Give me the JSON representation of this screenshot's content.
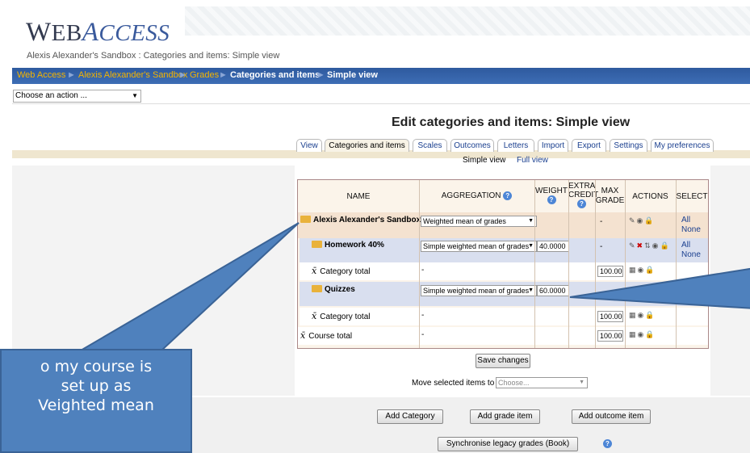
{
  "header": {
    "logo_part1": "W",
    "logo_part2": "EB",
    "logo_part3": "A",
    "logo_part4": "CCESS",
    "subtitle": "Alexis Alexander's Sandbox : Categories and items: Simple view"
  },
  "breadcrumb": [
    "Web Access",
    "Alexis Alexander's Sandbox",
    "Grades",
    "Categories and items",
    "Simple view"
  ],
  "breadcrumb_sep": "►",
  "action_chooser": "Choose an action ...",
  "page_title": "Edit categories and items: Simple view",
  "tabs": [
    "View",
    "Categories and items",
    "Scales",
    "Outcomes",
    "Letters",
    "Import",
    "Export",
    "Settings",
    "My preferences"
  ],
  "subtabs": {
    "simple": "Simple view",
    "full": "Full view"
  },
  "table": {
    "headers": {
      "name": "NAME",
      "aggregation": "AGGREGATION",
      "weight": "WEIGHT",
      "extra1": "EXTRA",
      "extra2": "CREDIT",
      "max1": "MAX",
      "max2": "GRADE",
      "actions": "ACTIONS",
      "select": "SELECT"
    },
    "rows": [
      {
        "name": "Alexis Alexander's Sandbox",
        "aggregation": "Weighted mean of grades",
        "weight": "",
        "max": "-",
        "select_all": "All",
        "select_none": "None"
      },
      {
        "name": "Homework 40%",
        "aggregation": "Simple weighted mean of grades",
        "weight": "40.0000",
        "max": "-",
        "select_all": "All",
        "select_none": "None"
      },
      {
        "name": "Category total",
        "aggregation": "-",
        "max": "100.00"
      },
      {
        "name": "Quizzes",
        "aggregation": "Simple weighted mean of grades",
        "weight": "60.0000"
      },
      {
        "name": "Category total",
        "aggregation": "-",
        "max": "100.00"
      },
      {
        "name": "Course total",
        "aggregation": "-",
        "max": "100.00"
      }
    ]
  },
  "save_button": "Save changes",
  "move_label": "Move selected items to",
  "move_select": "Choose...",
  "buttons": {
    "add_category": "Add Category",
    "add_grade_item": "Add grade item",
    "add_outcome_item": "Add outcome item",
    "sync": "Synchronise legacy grades (Book)"
  },
  "callout": {
    "line1": "o my course is",
    "line2": "set up as",
    "line3": "Veighted mean"
  },
  "colors": {
    "nav": "#2e5a9e",
    "callout": "#4f81bd",
    "category_row": "#f4e2d0",
    "subcategory_row": "#d9dfef"
  }
}
